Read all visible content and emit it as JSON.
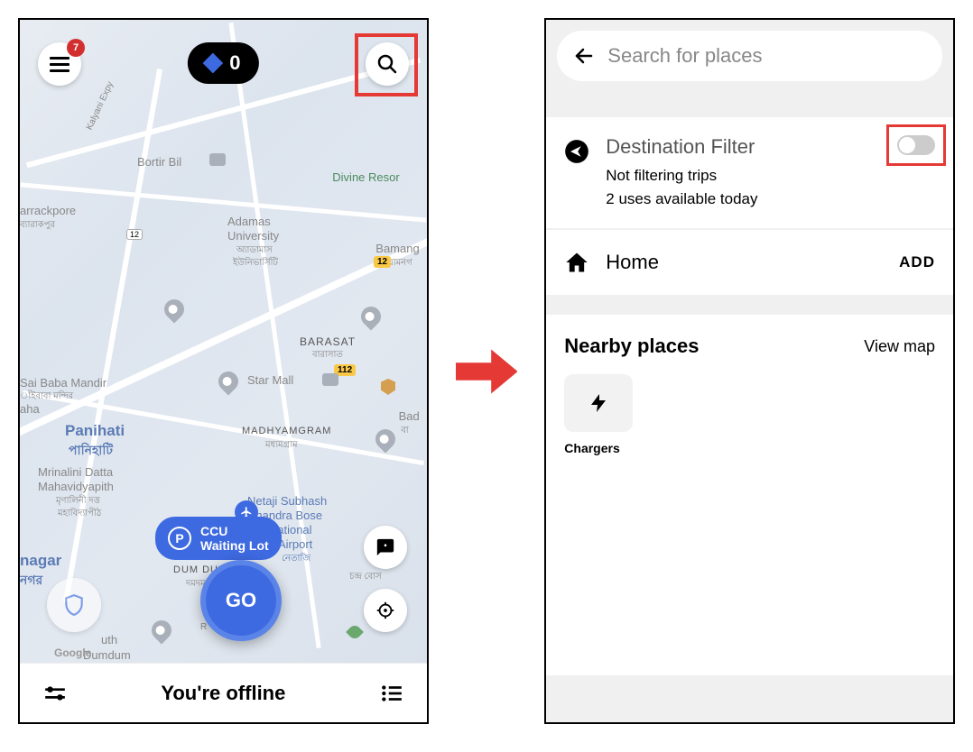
{
  "left": {
    "menu_badge": "7",
    "counter_value": "0",
    "waiting_code": "CCU",
    "waiting_label": "Waiting Lot",
    "waiting_p": "P",
    "go_label": "GO",
    "offline_text": "You're offline",
    "attrib": "Google",
    "places": {
      "bortir": "Bortir Bil",
      "divine": "Divine Resor",
      "adamas1": "Adamas",
      "adamas2": "University",
      "adamas3": "অ্যাডামাস",
      "adamas4": "ইউনিভার্সিটি",
      "barrackpore": "arrackpore",
      "barrackpore_bn": "ব্যারাকপুর",
      "bamang": "Bamang",
      "bamang_bn": "বামনগ",
      "barasat": "BARASAT",
      "barasat_bn": "বারাসাত",
      "starmall": "Star Mall",
      "sai1": "Sai Baba Mandir",
      "sai2": "াঁইবাবা মন্দির",
      "aha": "aha",
      "panihati": "Panihati",
      "panihati_bn": "পানিহাটি",
      "madhya": "MADHYAMGRAM",
      "madhya_bn": "মধ্যমগ্রাম",
      "bad": "Bad",
      "bad_bn": "বা",
      "mrinal1": "Mrinalini Datta",
      "mrinal2": "Mahavidyapith",
      "mrinal3": "মৃণালিনী দত্ত",
      "mrinal4": "মহাবিদ্যাপীঠ",
      "netaji1": "Netaji Subhash",
      "netaji2": "Chandra Bose",
      "netaji3": "International",
      "netaji4": "Airport",
      "netaji_bn": "নেতাজি",
      "dumdum": "DUM DUM",
      "dumdum_bn": "দমদম",
      "chandra": "চন্দ্র বোস",
      "nagar": "nagar",
      "nagar_bn": "নগর",
      "uth": "uth",
      "dumdum2": "Dumdum",
      "r": "R",
      "route112": "112",
      "route12": "12",
      "kalyani": "Kalyani Expy"
    }
  },
  "right": {
    "search_placeholder": "Search for places",
    "filter": {
      "title": "Destination Filter",
      "sub1": "Not filtering trips",
      "sub2": "2 uses available today"
    },
    "home_label": "Home",
    "add_label": "ADD",
    "nearby_title": "Nearby places",
    "view_map": "View map",
    "chargers": "Chargers"
  }
}
